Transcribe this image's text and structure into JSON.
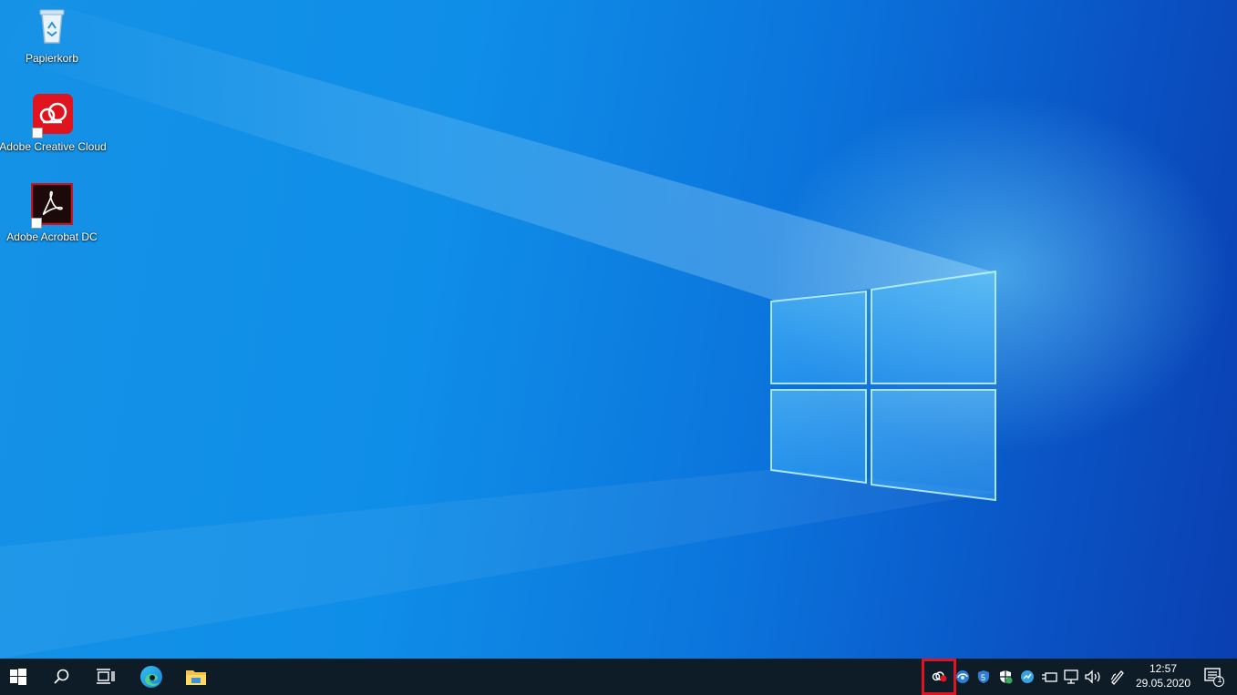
{
  "desktop": {
    "icons": [
      {
        "label": "Papierkorb",
        "icon": "recycle-bin-icon"
      },
      {
        "label": "Adobe Creative Cloud",
        "icon": "creative-cloud-icon"
      },
      {
        "label": "Adobe Acrobat DC",
        "icon": "acrobat-icon"
      }
    ]
  },
  "taskbar": {
    "start": "windows-start-icon",
    "search": "search-icon",
    "task_view": "task-view-icon",
    "pinned": [
      "edge-icon",
      "file-explorer-icon"
    ],
    "tray": [
      "creative-cloud-tray-icon",
      "browser-tray-icon",
      "shield-tray-icon",
      "defender-tray-icon",
      "sync-tray-icon",
      "power-plug-icon",
      "network-icon",
      "volume-icon",
      "pen-icon"
    ],
    "clock": {
      "time": "12:57",
      "date": "29.05.2020"
    },
    "notifications": {
      "count": "1"
    }
  },
  "colors": {
    "highlight": "#e0141e",
    "taskbar": "#0d1c27",
    "desktop_accent": "#0f8ee8"
  }
}
